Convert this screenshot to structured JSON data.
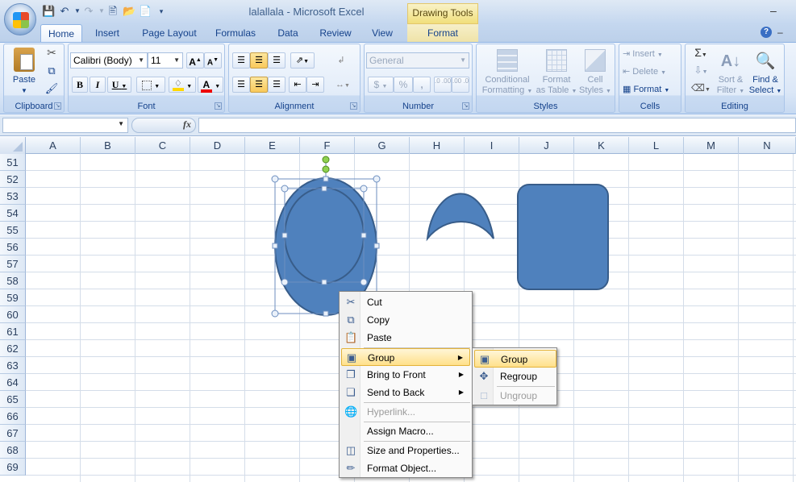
{
  "window": {
    "title": "lalallala - Microsoft Excel",
    "contextual_tab_group": "Drawing Tools"
  },
  "tabs": [
    "Home",
    "Insert",
    "Page Layout",
    "Formulas",
    "Data",
    "Review",
    "View",
    "Format"
  ],
  "active_tab": "Home",
  "ribbon": {
    "clipboard": {
      "label": "Clipboard",
      "paste": "Paste"
    },
    "font": {
      "label": "Font",
      "font_name": "Calibri (Body)",
      "font_size": "11",
      "bold": "B",
      "italic": "I",
      "underline": "U",
      "grow": "A",
      "shrink": "A"
    },
    "alignment": {
      "label": "Alignment"
    },
    "number": {
      "label": "Number",
      "format": "General",
      "currency": "$",
      "percent": "%",
      "comma": ",",
      "inc_decimal": ".0 .00",
      "dec_decimal": ".00 .0"
    },
    "styles": {
      "label": "Styles",
      "conditional": "Conditional Formatting",
      "cond_line1": "Conditional",
      "cond_line2": "Formatting",
      "format_table_line1": "Format",
      "format_table_line2": "as Table",
      "cell_styles_line1": "Cell",
      "cell_styles_line2": "Styles"
    },
    "cells": {
      "label": "Cells",
      "insert": "Insert",
      "delete": "Delete",
      "format": "Format"
    },
    "editing": {
      "label": "Editing",
      "sum": "Σ",
      "sort_line1": "Sort &",
      "sort_line2": "Filter",
      "find_line1": "Find &",
      "find_line2": "Select"
    }
  },
  "formula_bar": {
    "name_box": "",
    "fx": "fx",
    "formula": ""
  },
  "columns": [
    "A",
    "B",
    "C",
    "D",
    "E",
    "F",
    "G",
    "H",
    "I",
    "J",
    "K",
    "L",
    "M",
    "N"
  ],
  "rows": [
    "51",
    "52",
    "53",
    "54",
    "55",
    "56",
    "57",
    "58",
    "59",
    "60",
    "61",
    "62",
    "63",
    "64",
    "65",
    "66",
    "67",
    "68",
    "69"
  ],
  "shapes": {
    "fill": "#4f81bd",
    "stroke": "#385d8a"
  },
  "context_menu": {
    "items": [
      {
        "label": "Cut",
        "icon": "scissors-icon"
      },
      {
        "label": "Copy",
        "icon": "copy-icon"
      },
      {
        "label": "Paste",
        "icon": "paste-icon"
      },
      {
        "label": "Group",
        "icon": "group-icon",
        "submenu": true,
        "highlighted": true
      },
      {
        "label": "Bring to Front",
        "icon": "bring-front-icon",
        "submenu": true
      },
      {
        "label": "Send to Back",
        "icon": "send-back-icon",
        "submenu": true
      },
      {
        "label": "Hyperlink...",
        "icon": "hyperlink-icon",
        "disabled": true
      },
      {
        "label": "Assign Macro...",
        "icon": ""
      },
      {
        "label": "Size and Properties...",
        "icon": "size-icon"
      },
      {
        "label": "Format Object...",
        "icon": "format-object-icon"
      }
    ],
    "submenu": [
      {
        "label": "Group",
        "icon": "group-icon",
        "highlighted": true
      },
      {
        "label": "Regroup",
        "icon": "regroup-icon"
      },
      {
        "label": "Ungroup",
        "icon": "ungroup-icon",
        "disabled": true
      }
    ]
  }
}
